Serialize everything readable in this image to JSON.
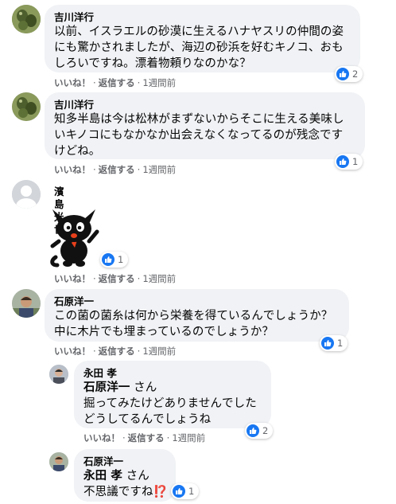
{
  "actions": {
    "like": "いいね！",
    "reply": "返信する",
    "dot": "·"
  },
  "comments": [
    {
      "author": "吉川洋行",
      "lines": [
        "以前、イスラエルの砂漠に生えるハナヤスリの仲間の姿",
        "にも驚かされましたが、海辺の砂浜を好むキノコ、おも",
        "しろいですね。漂着物頼りなのかな？"
      ],
      "time": "1週間前",
      "reactions": "2"
    },
    {
      "author": "吉川洋行",
      "lines": [
        "知多半島は今は松林がまずないからそこに生える美味し",
        "いキノコにもなかなか出会えなくなってるのが残念です",
        "けどね。"
      ],
      "time": "1週間前",
      "reactions": "1"
    },
    {
      "author": "濱島光世",
      "sticker": "black-cat-sticker",
      "time": "1週間前",
      "reactions": "1"
    },
    {
      "author": "石原洋一",
      "lines": [
        "この菌の菌糸は何から栄養を得ているんでしょうか？",
        "中に木片でも埋まっているのでしょうか？"
      ],
      "time": "1週間前",
      "reactions": "1"
    },
    {
      "author": "永田 孝",
      "mention": "石原洋一",
      "mention_suffix": " さん",
      "lines": [
        "掘ってみたけどありませんでした",
        "どうしてるんでしょうね"
      ],
      "time": "1週間前",
      "reactions": "2"
    },
    {
      "author": "石原洋一",
      "mention": "永田 孝",
      "mention_suffix": " さん",
      "lines": [
        "不思議ですね⁉️"
      ],
      "reactions": "1"
    }
  ]
}
